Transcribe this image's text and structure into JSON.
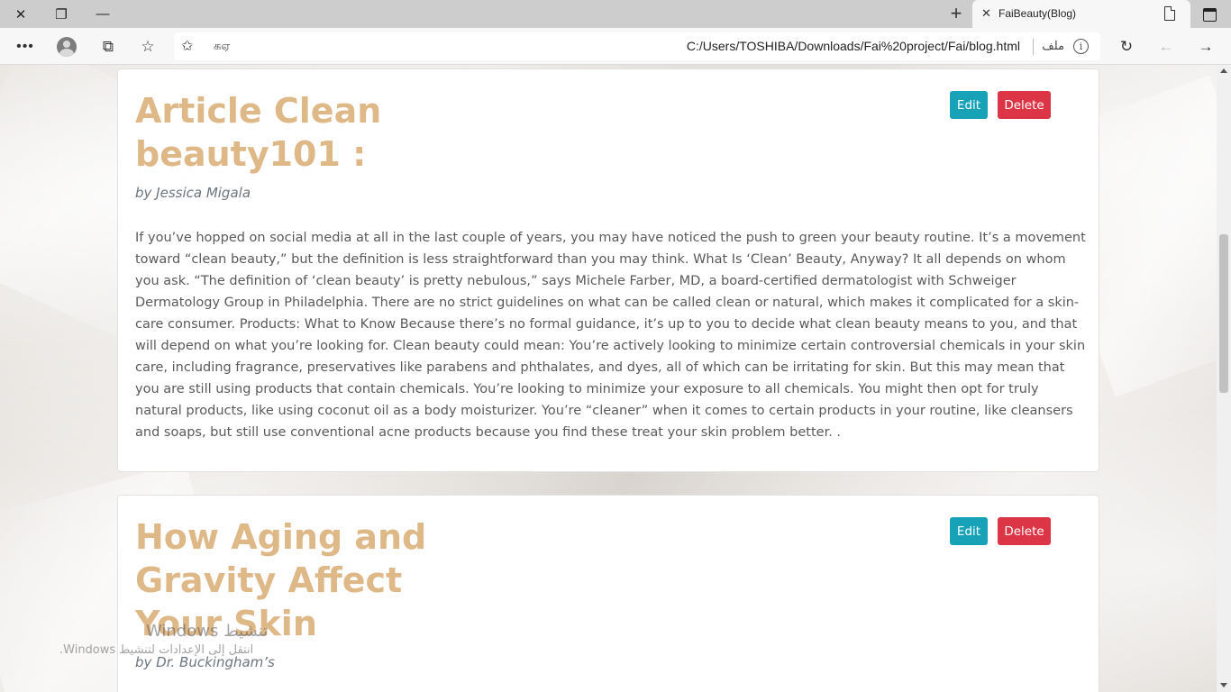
{
  "browser": {
    "tab_title": "FaiBeauty(Blog)",
    "url": "C:/Users/TOSHIBA/Downloads/Fai%20project/Fai/blog.html",
    "file_label": "ملف",
    "reader_label": "கஏ",
    "info_glyph": "i"
  },
  "posts": [
    {
      "title": "Article Clean beauty101 :",
      "author": "by Jessica Migala",
      "body": "If you’ve hopped on social media at all in the last couple of years, you may have noticed the push to green your beauty routine. It’s a movement toward “clean beauty,” but the definition is less straightforward than you may think. What Is ‘Clean’ Beauty, Anyway? It all depends on whom you ask. “The definition of ‘clean beauty’ is pretty nebulous,” says Michele Farber, MD, a board-certified dermatologist with Schweiger Dermatology Group in Philadelphia. There are no strict guidelines on what can be called clean or natural, which makes it complicated for a skin-care consumer. Products: What to Know Because there’s no formal guidance, it’s up to you to decide what clean beauty means to you, and that will depend on what you’re looking for. Clean beauty could mean: You’re actively looking to minimize certain controversial chemicals in your skin care, including fragrance, preservatives like parabens and phthalates, and dyes, all of which can be irritating for skin. But this may mean that you are still using products that contain chemicals. You’re looking to minimize your exposure to all chemicals. You might then opt for truly natural products, like using coconut oil as a body moisturizer. You’re “cleaner” when it comes to certain products in your routine, like cleansers and soaps, but still use conventional acne products because you find these treat your skin problem better. .",
      "edit_label": "Edit",
      "delete_label": "Delete"
    },
    {
      "title": "How Aging and Gravity Affect Your Skin",
      "author": "by Dr. Buckingham’s",
      "edit_label": "Edit",
      "delete_label": "Delete"
    }
  ],
  "watermark": {
    "line1": "تنشيط Windows",
    "line2": "انتقل إلى الإعدادات لتنشيط Windows."
  },
  "colors": {
    "title": "#deb887",
    "edit": "#17a2b8",
    "delete": "#dc3545"
  }
}
